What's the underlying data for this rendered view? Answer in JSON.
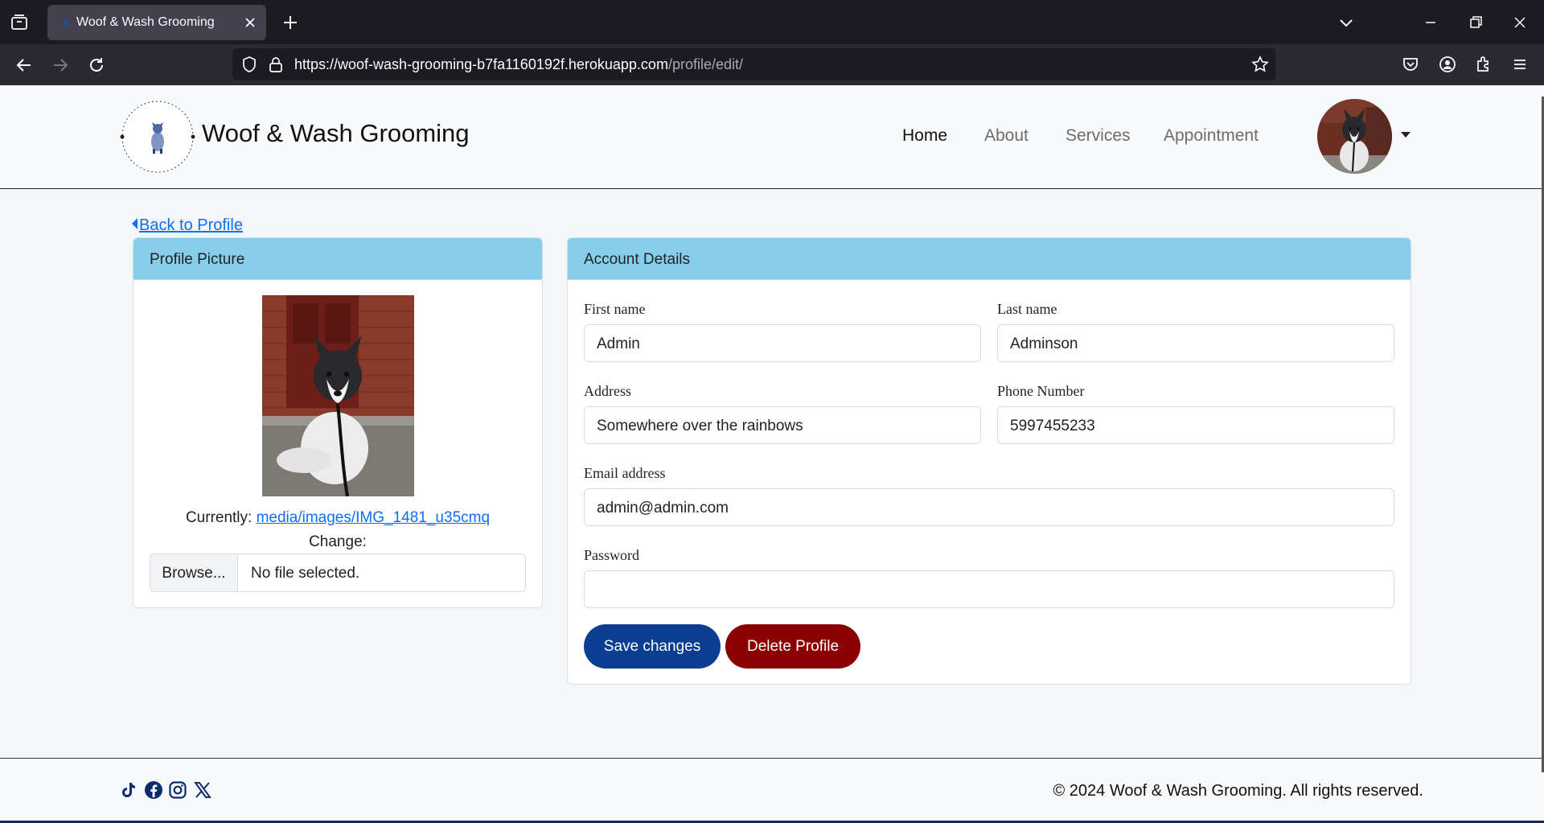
{
  "browser": {
    "tab_title": "Woof & Wash Grooming",
    "url_domain": "https://woof-wash-grooming-b7fa1160192f.herokuapp.com",
    "url_path": "/profile/edit/"
  },
  "header": {
    "brand": "Woof & Wash Grooming",
    "nav": [
      "Home",
      "About",
      "Services",
      "Appointment"
    ],
    "active_nav": "Home"
  },
  "back_link": "Back to Profile",
  "profile_picture": {
    "title": "Profile Picture",
    "currently_label": "Currently:",
    "current_file": "media/images/IMG_1481_u35cmq",
    "change_label": "Change:",
    "browse_label": "Browse...",
    "file_status": "No file selected."
  },
  "account": {
    "title": "Account Details",
    "first_name_label": "First name",
    "first_name": "Admin",
    "last_name_label": "Last name",
    "last_name": "Adminson",
    "address_label": "Address",
    "address": "Somewhere over the rainbows",
    "phone_label": "Phone Number",
    "phone": "5997455233",
    "email_label": "Email address",
    "email": "admin@admin.com",
    "password_label": "Password",
    "password": "",
    "save_label": "Save changes",
    "delete_label": "Delete Profile"
  },
  "footer": {
    "social": [
      "tiktok-icon",
      "facebook-icon",
      "instagram-icon",
      "x-icon"
    ],
    "copyright": "© 2024 Woof & Wash Grooming. All rights reserved."
  },
  "colors": {
    "card_header": "#87ceeb",
    "save_button": "#0b3e91",
    "delete_button": "#8b0000",
    "link": "#0d6efd"
  }
}
